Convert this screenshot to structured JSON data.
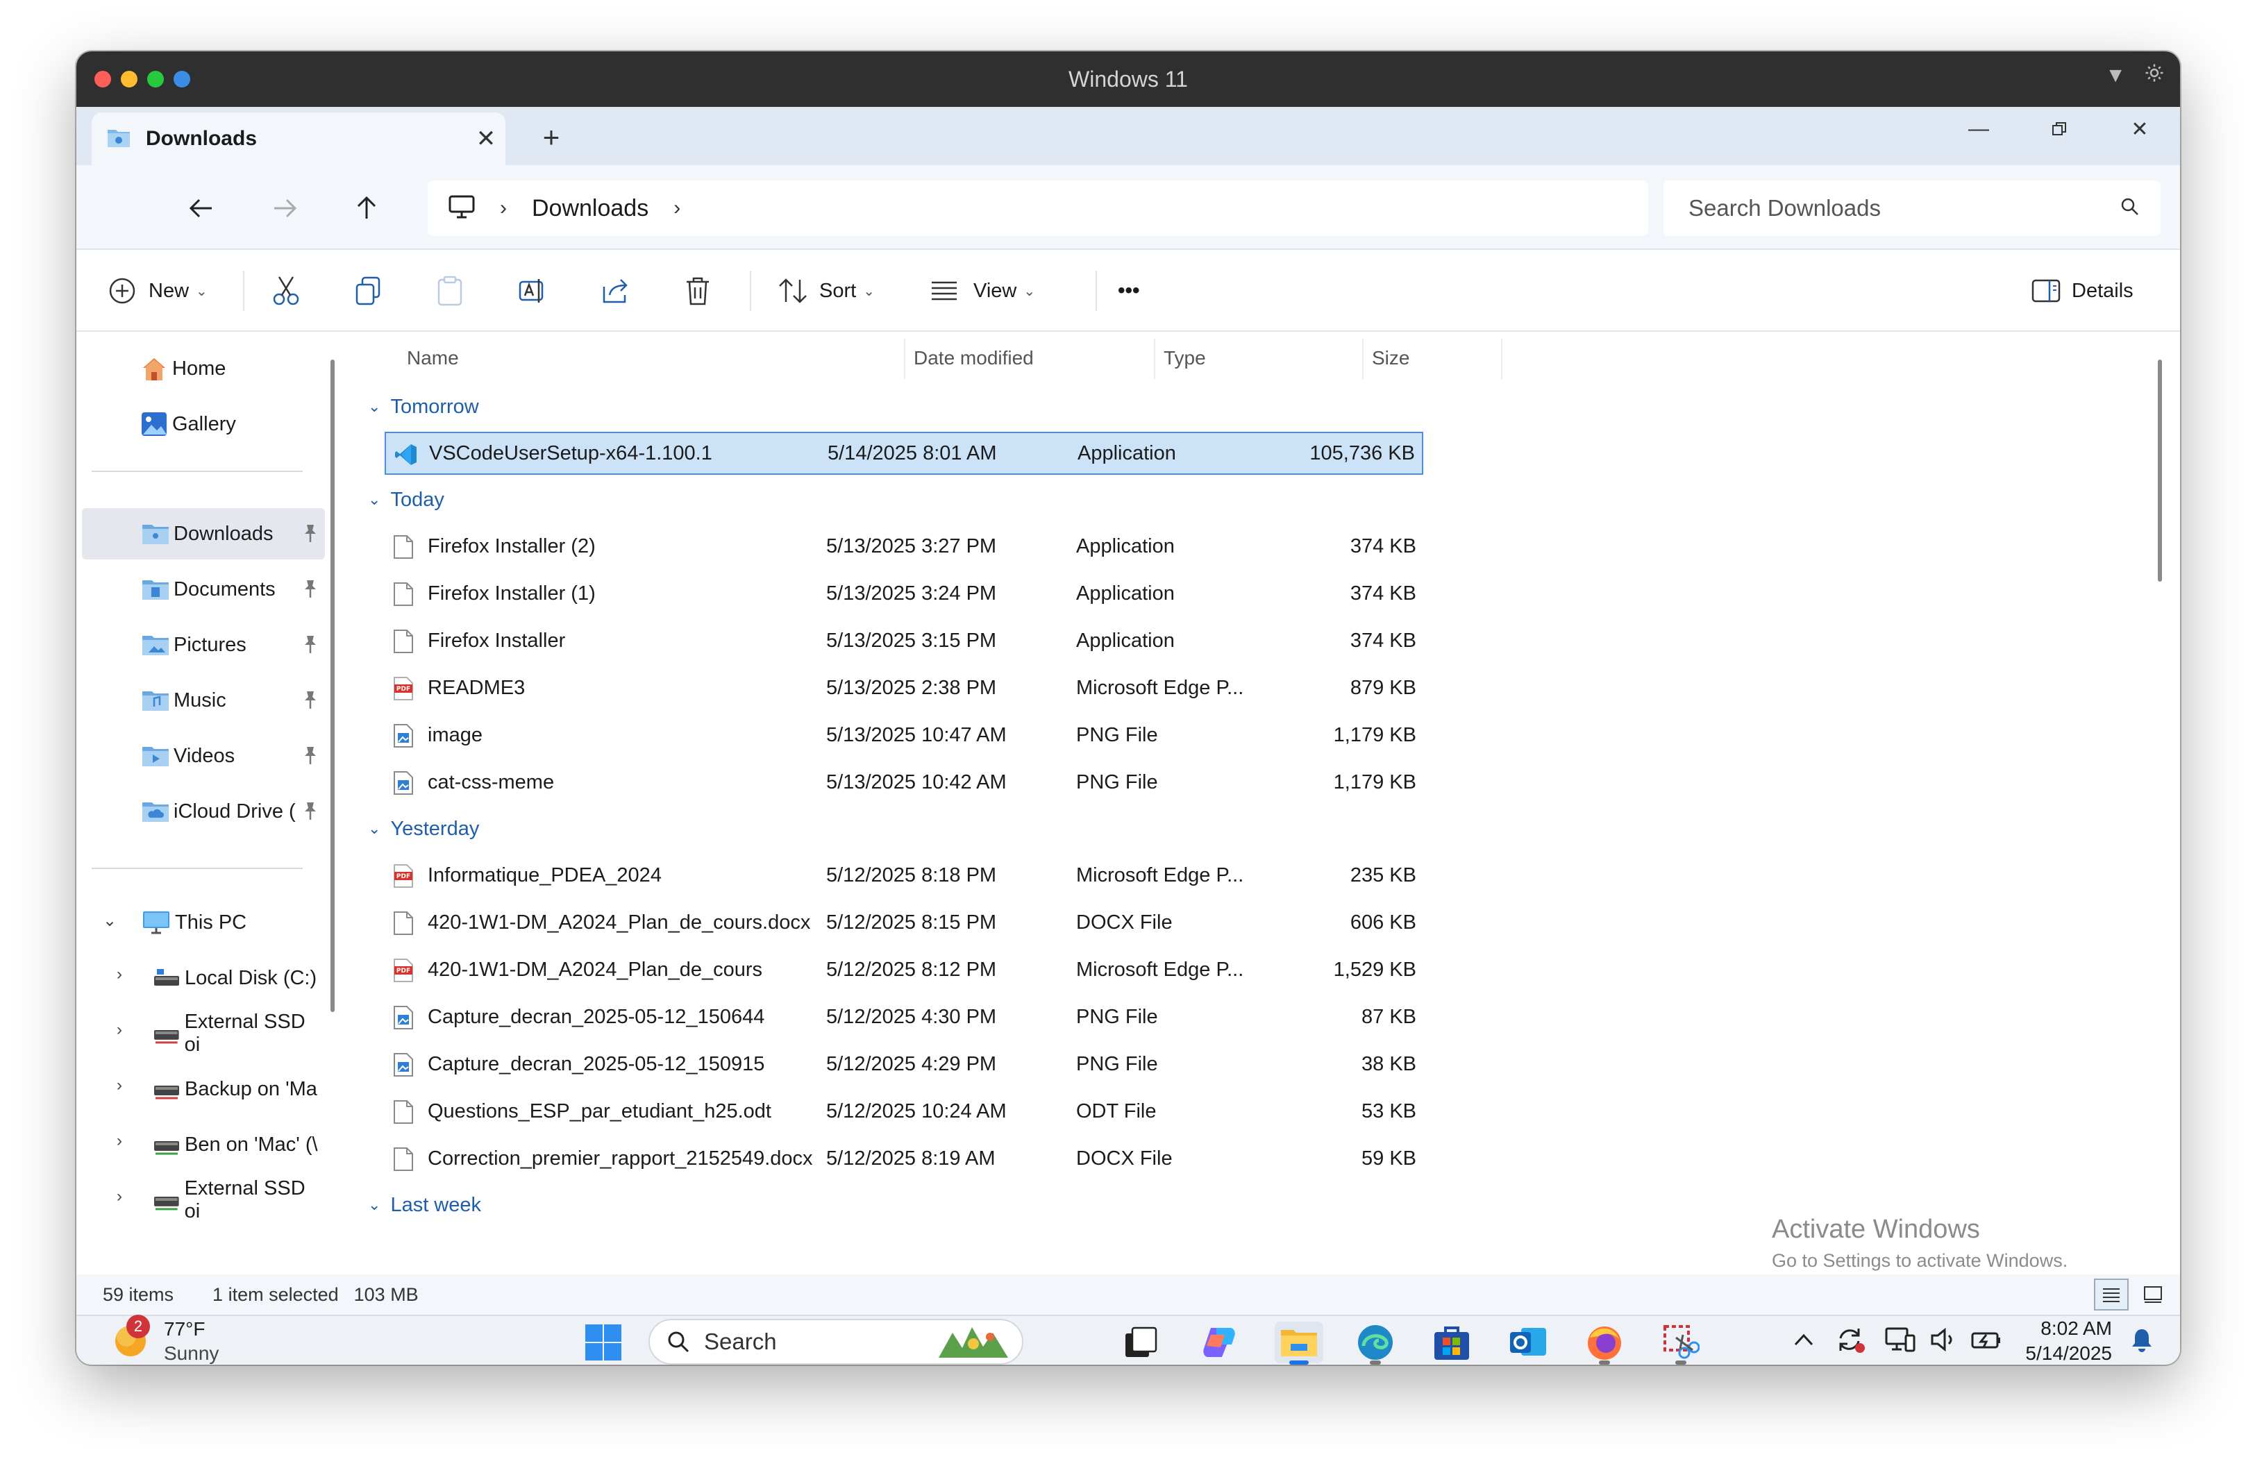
{
  "mac": {
    "title": "Windows 11"
  },
  "tab": {
    "label": "Downloads",
    "close_glyph": "✕",
    "add_glyph": "+"
  },
  "address": {
    "crumbs": [
      "Downloads"
    ],
    "search_placeholder": "Search Downloads"
  },
  "commands": {
    "new_label": "New",
    "sort_label": "Sort",
    "view_label": "View",
    "more_label": "•••",
    "details_label": "Details"
  },
  "sidebar": {
    "home": "Home",
    "gallery": "Gallery",
    "pinned": [
      {
        "label": "Downloads",
        "active": true
      },
      {
        "label": "Documents"
      },
      {
        "label": "Pictures"
      },
      {
        "label": "Music"
      },
      {
        "label": "Videos"
      },
      {
        "label": "iCloud Drive ("
      }
    ],
    "this_pc": "This PC",
    "drives": [
      {
        "label": "Local Disk (C:)"
      },
      {
        "label": "External SSD oi"
      },
      {
        "label": "Backup on 'Ma"
      },
      {
        "label": "Ben on 'Mac' (\\"
      },
      {
        "label": "External SSD oi"
      }
    ]
  },
  "columns": {
    "name": "Name",
    "date": "Date modified",
    "type": "Type",
    "size": "Size"
  },
  "groups": [
    {
      "label": "Tomorrow",
      "files": [
        {
          "name": "VSCodeUserSetup-x64-1.100.1",
          "date": "5/14/2025 8:01 AM",
          "type": "Application",
          "size": "105,736 KB",
          "icon": "vscode-icon",
          "selected": true
        }
      ]
    },
    {
      "label": "Today",
      "files": [
        {
          "name": "Firefox Installer (2)",
          "date": "5/13/2025 3:27 PM",
          "type": "Application",
          "size": "374 KB",
          "icon": "file-icon"
        },
        {
          "name": "Firefox Installer (1)",
          "date": "5/13/2025 3:24 PM",
          "type": "Application",
          "size": "374 KB",
          "icon": "file-icon"
        },
        {
          "name": "Firefox Installer",
          "date": "5/13/2025 3:15 PM",
          "type": "Application",
          "size": "374 KB",
          "icon": "file-icon"
        },
        {
          "name": "README3",
          "date": "5/13/2025 2:38 PM",
          "type": "Microsoft Edge P...",
          "size": "879 KB",
          "icon": "pdf-icon"
        },
        {
          "name": "image",
          "date": "5/13/2025 10:47 AM",
          "type": "PNG File",
          "size": "1,179 KB",
          "icon": "image-icon"
        },
        {
          "name": "cat-css-meme",
          "date": "5/13/2025 10:42 AM",
          "type": "PNG File",
          "size": "1,179 KB",
          "icon": "image-icon"
        }
      ]
    },
    {
      "label": "Yesterday",
      "files": [
        {
          "name": "Informatique_PDEA_2024",
          "date": "5/12/2025 8:18 PM",
          "type": "Microsoft Edge P...",
          "size": "235 KB",
          "icon": "pdf-icon"
        },
        {
          "name": "420-1W1-DM_A2024_Plan_de_cours.docx",
          "date": "5/12/2025 8:15 PM",
          "type": "DOCX File",
          "size": "606 KB",
          "icon": "file-icon"
        },
        {
          "name": "420-1W1-DM_A2024_Plan_de_cours",
          "date": "5/12/2025 8:12 PM",
          "type": "Microsoft Edge P...",
          "size": "1,529 KB",
          "icon": "pdf-icon"
        },
        {
          "name": "Capture_decran_2025-05-12_150644",
          "date": "5/12/2025 4:30 PM",
          "type": "PNG File",
          "size": "87 KB",
          "icon": "image-icon"
        },
        {
          "name": "Capture_decran_2025-05-12_150915",
          "date": "5/12/2025 4:29 PM",
          "type": "PNG File",
          "size": "38 KB",
          "icon": "image-icon"
        },
        {
          "name": "Questions_ESP_par_etudiant_h25.odt",
          "date": "5/12/2025 10:24 AM",
          "type": "ODT File",
          "size": "53 KB",
          "icon": "file-icon"
        },
        {
          "name": "Correction_premier_rapport_2152549.docx",
          "date": "5/12/2025 8:19 AM",
          "type": "DOCX File",
          "size": "59 KB",
          "icon": "file-icon"
        }
      ]
    },
    {
      "label": "Last week",
      "files": []
    }
  ],
  "watermark": {
    "title": "Activate Windows",
    "subtitle": "Go to Settings to activate Windows."
  },
  "status": {
    "items": "59 items",
    "selected": "1 item selected",
    "size": "103 MB"
  },
  "taskbar": {
    "weather_temp": "77°F",
    "weather_cond": "Sunny",
    "weather_badge": "2",
    "search_label": "Search",
    "time": "8:02 AM",
    "date": "5/14/2025"
  },
  "colors": {
    "accent": "#0067c0",
    "selection": "#cce2f7",
    "group_header": "#1f5ea8"
  }
}
